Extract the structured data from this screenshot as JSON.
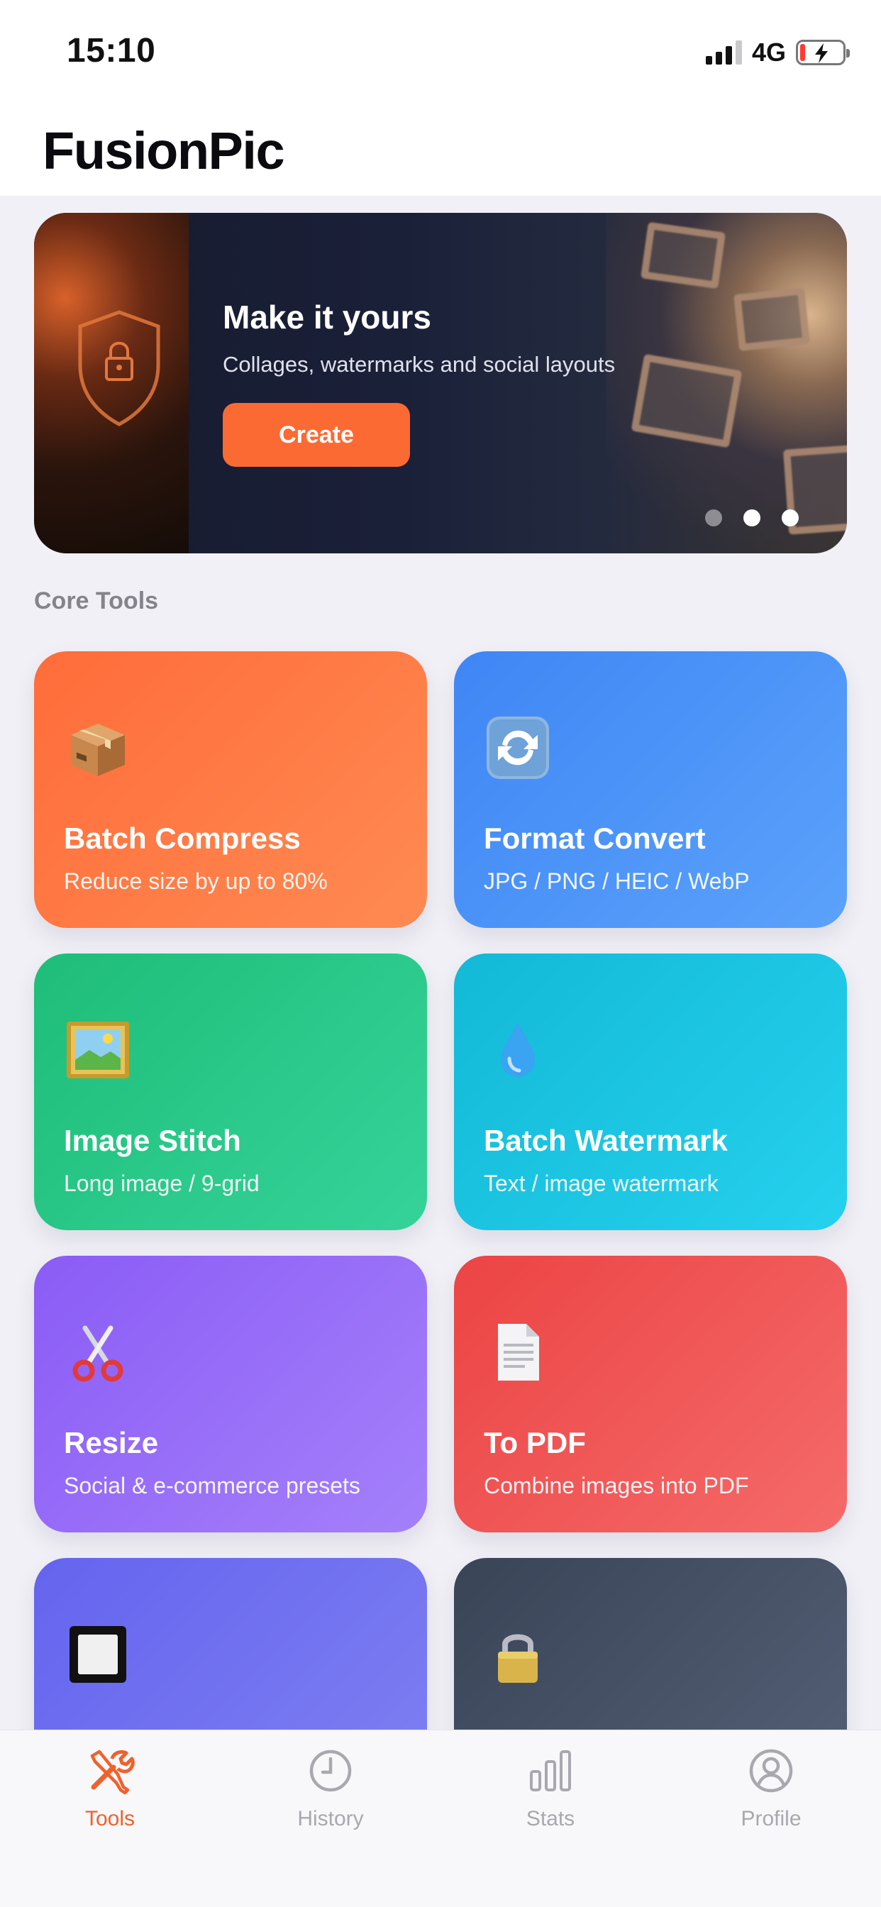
{
  "status_bar": {
    "time": "15:10",
    "network": "4G"
  },
  "app": {
    "title": "FusionPic"
  },
  "banner": {
    "heading": "Make it yours",
    "subtitle": "Collages, watermarks and social layouts",
    "cta_label": "Create",
    "active_slide": 3,
    "slide_count": 3
  },
  "section": {
    "core_tools_label": "Core Tools"
  },
  "tools": [
    {
      "title": "Batch Compress",
      "desc": "Reduce size by up to 80%",
      "icon": "package-icon",
      "color": "#ff6c3a"
    },
    {
      "title": "Format Convert",
      "desc": "JPG / PNG / HEIC / WebP",
      "icon": "convert-arrows-icon",
      "color": "#3f86f5"
    },
    {
      "title": "Image Stitch",
      "desc": "Long image / 9-grid",
      "icon": "framed-picture-icon",
      "color": "#1fbd78"
    },
    {
      "title": "Batch Watermark",
      "desc": "Text / image watermark",
      "icon": "droplet-icon",
      "color": "#13b9d6"
    },
    {
      "title": "Resize",
      "desc": "Social & e-commerce presets",
      "icon": "scissors-icon",
      "color": "#8b5cf6"
    },
    {
      "title": "To PDF",
      "desc": "Combine images into PDF",
      "icon": "document-icon",
      "color": "#ec4444"
    },
    {
      "title": "",
      "desc": "",
      "icon": "white-square-icon",
      "color": "#6464ef"
    },
    {
      "title": "",
      "desc": "",
      "icon": "padlock-icon",
      "color": "#3a4457"
    }
  ],
  "tab_bar": {
    "active": "Tools",
    "accent_color": "#f0612c",
    "tabs": [
      {
        "label": "Tools",
        "icon": "tools-icon"
      },
      {
        "label": "History",
        "icon": "clock-icon"
      },
      {
        "label": "Stats",
        "icon": "bar-chart-icon"
      },
      {
        "label": "Profile",
        "icon": "person-icon"
      }
    ]
  }
}
